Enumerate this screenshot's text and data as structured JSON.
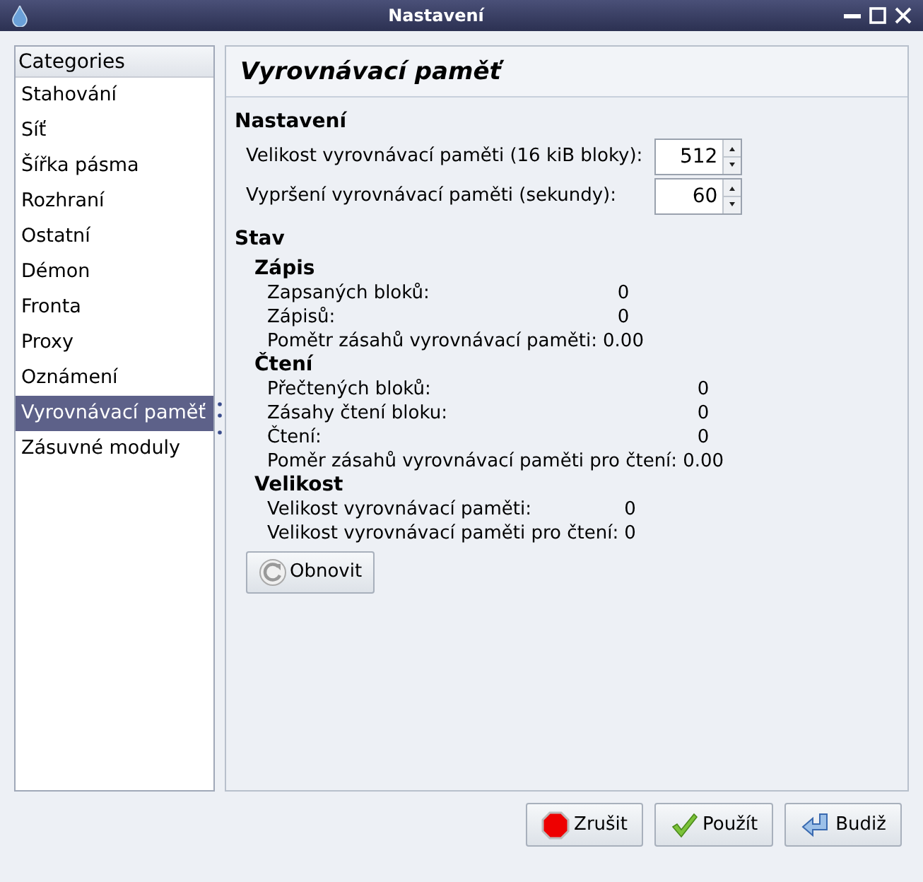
{
  "window": {
    "title": "Nastavení"
  },
  "sidebar": {
    "header": "Categories",
    "items": [
      {
        "label": "Stahování",
        "selected": false
      },
      {
        "label": "Síť",
        "selected": false
      },
      {
        "label": "Šířka pásma",
        "selected": false
      },
      {
        "label": "Rozhraní",
        "selected": false
      },
      {
        "label": "Ostatní",
        "selected": false
      },
      {
        "label": "Démon",
        "selected": false
      },
      {
        "label": "Fronta",
        "selected": false
      },
      {
        "label": "Proxy",
        "selected": false
      },
      {
        "label": "Oznámení",
        "selected": false
      },
      {
        "label": "Vyrovnávací paměť",
        "selected": true
      },
      {
        "label": "Zásuvné moduly",
        "selected": false
      }
    ]
  },
  "page": {
    "title": "Vyrovnávací paměť",
    "settings": {
      "heading": "Nastavení",
      "fields": [
        {
          "label": "Velikost vyrovnávací paměti (16 kiB bloky):",
          "value": "512"
        },
        {
          "label": "Vypršení vyrovnávací paměti (sekundy):",
          "value": "60"
        }
      ]
    },
    "status": {
      "heading": "Stav",
      "groups": [
        {
          "heading": "Zápis",
          "rows": [
            {
              "label": "Zapsaných bloků:",
              "value": "0"
            },
            {
              "label": "Zápisů:",
              "value": "0"
            },
            {
              "label": "Pomětr zásahů vyrovnávací paměti:",
              "value": "0.00"
            }
          ]
        },
        {
          "heading": "Čtení",
          "rows": [
            {
              "label": "Přečtených bloků:",
              "value": "0"
            },
            {
              "label": "Zásahy čtení bloku:",
              "value": "0"
            },
            {
              "label": "Čtení:",
              "value": "0"
            },
            {
              "label": "Poměr zásahů vyrovnávací paměti pro čtení:",
              "value": "0.00"
            }
          ]
        },
        {
          "heading": "Velikost",
          "rows": [
            {
              "label": "Velikost vyrovnávací paměti:",
              "value": "0"
            },
            {
              "label": "Velikost vyrovnávací paměti pro čtení:",
              "value": "0"
            }
          ]
        }
      ]
    },
    "refresh_button": "Obnovit"
  },
  "buttons": [
    {
      "label": "Zrušit",
      "kind": "cancel"
    },
    {
      "label": "Použít",
      "kind": "apply"
    },
    {
      "label": "Budiž",
      "kind": "ok"
    }
  ]
}
